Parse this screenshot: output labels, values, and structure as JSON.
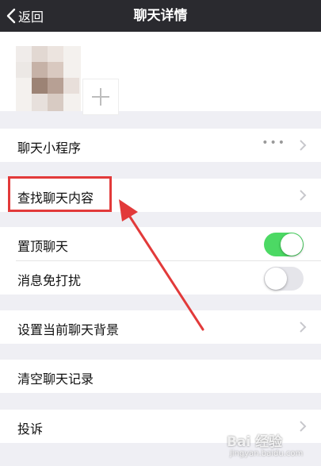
{
  "nav": {
    "back_label": "返回",
    "title": "聊天详情"
  },
  "rows": {
    "mini_programs": {
      "label": "聊天小程序",
      "more_indicator": "•••"
    },
    "search_content": {
      "label": "查找聊天内容"
    },
    "sticky_on_top": {
      "label": "置顶聊天",
      "on": true
    },
    "mute_notifications": {
      "label": "消息免打扰",
      "on": false
    },
    "set_background": {
      "label": "设置当前聊天背景"
    },
    "clear_history": {
      "label": "清空聊天记录"
    },
    "complain": {
      "label": "投诉"
    }
  },
  "colors": {
    "nav_bg": "#2a2a2f",
    "toggle_on": "#4cd964",
    "toggle_off": "#e5e5ea",
    "annotation": "#e23a3a"
  },
  "watermark": {
    "brand": "Bai 经验",
    "url": "jingyan.baidu.com"
  }
}
